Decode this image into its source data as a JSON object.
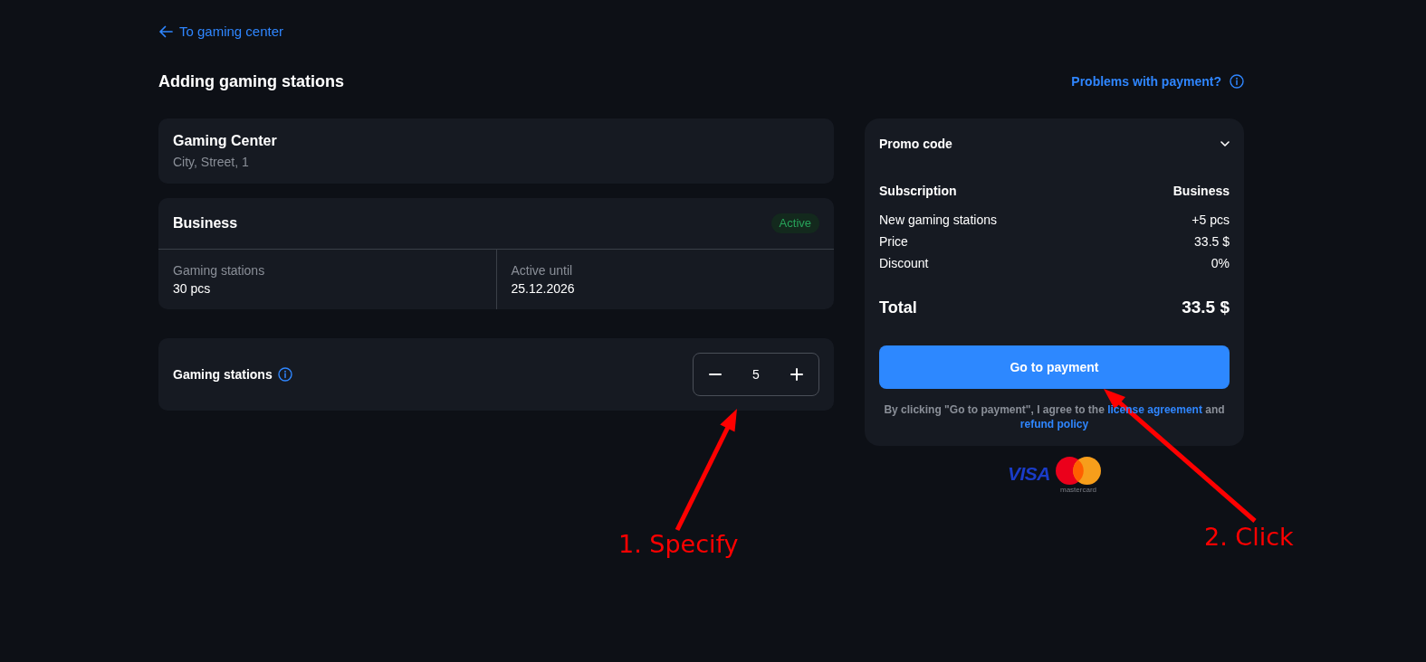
{
  "back_link": {
    "label": "To gaming center"
  },
  "header": {
    "title": "Adding gaming stations",
    "help_link": "Problems with payment?"
  },
  "club": {
    "name": "Gaming Center",
    "address": "City, Street, 1"
  },
  "plan": {
    "name": "Business",
    "badge": "Active",
    "stats": [
      {
        "label": "Gaming stations",
        "value": "30 pcs"
      },
      {
        "label": "Active until",
        "value": "25.12.2026"
      }
    ]
  },
  "stations": {
    "label": "Gaming stations",
    "quantity": "5"
  },
  "summary": {
    "promo": {
      "label": "Promo code",
      "expanded": false
    },
    "rows": [
      {
        "kind": "heading",
        "label": "Subscription",
        "value": "Business"
      },
      {
        "kind": "line",
        "label": "New gaming stations",
        "value": "+5 pcs"
      },
      {
        "kind": "line",
        "label": "Price",
        "value": "33.5 $"
      },
      {
        "kind": "line",
        "label": "Discount",
        "value": "0%"
      }
    ],
    "total": {
      "label": "Total",
      "value": "33.5 $"
    },
    "pay_button": "Go to payment",
    "agreement": [
      {
        "kind": "text",
        "text": "By clicking \"Go to payment\", I agree to the "
      },
      {
        "kind": "link",
        "text": "license agreement"
      },
      {
        "kind": "text",
        "text": " and "
      },
      {
        "kind": "link",
        "text": "refund policy"
      }
    ]
  },
  "payment_logos": [
    {
      "kind": "visa",
      "label": "VISA"
    },
    {
      "kind": "mastercard",
      "label": "mastercard"
    }
  ],
  "annotations": [
    {
      "label": "1. Specify"
    },
    {
      "label": "2. Click"
    }
  ]
}
